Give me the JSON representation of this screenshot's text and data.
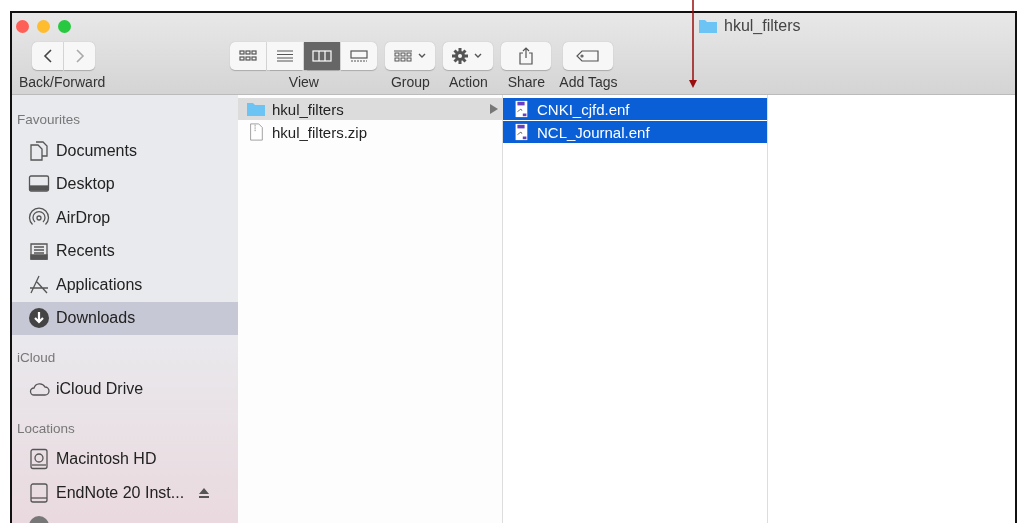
{
  "window": {
    "title": "hkul_filters"
  },
  "toolbar": {
    "nav_label": "Back/Forward",
    "view_modes": [
      {
        "kind": "icons",
        "selected": false
      },
      {
        "kind": "list",
        "selected": false
      },
      {
        "kind": "columns",
        "selected": true
      },
      {
        "kind": "gallery",
        "selected": false
      }
    ],
    "view_label": "View",
    "group_label": "Group",
    "action_label": "Action",
    "share_label": "Share",
    "tags_label": "Add Tags"
  },
  "sidebar": [
    {
      "heading": "Favourites",
      "items": [
        {
          "label": "Documents",
          "selected": false
        },
        {
          "label": "Desktop",
          "selected": false
        },
        {
          "label": "AirDrop",
          "selected": false
        },
        {
          "label": "Recents",
          "selected": false
        },
        {
          "label": "Applications",
          "selected": false
        },
        {
          "label": "Downloads",
          "selected": true
        }
      ]
    },
    {
      "heading": "iCloud",
      "items": [
        {
          "label": "iCloud Drive",
          "selected": false
        }
      ]
    },
    {
      "heading": "Locations",
      "items": [
        {
          "label": "Macintosh HD",
          "selected": false
        },
        {
          "label": "EndNote 20 Inst...",
          "selected": false,
          "eject": true
        },
        {
          "selected": false
        }
      ]
    }
  ],
  "columns": [
    {
      "focused": false,
      "items": [
        {
          "name": "hkul_filters",
          "kind": "folder",
          "selected": true,
          "expandable": true
        },
        {
          "name": "hkul_filters.zip",
          "kind": "zip",
          "selected": false,
          "expandable": false
        }
      ]
    },
    {
      "focused": true,
      "items": [
        {
          "name": "CNKI_cjfd.enf",
          "kind": "enf",
          "selected": true,
          "expandable": false
        },
        {
          "name": "NCL_Journal.enf",
          "kind": "enf",
          "selected": true,
          "expandable": false
        }
      ]
    }
  ]
}
